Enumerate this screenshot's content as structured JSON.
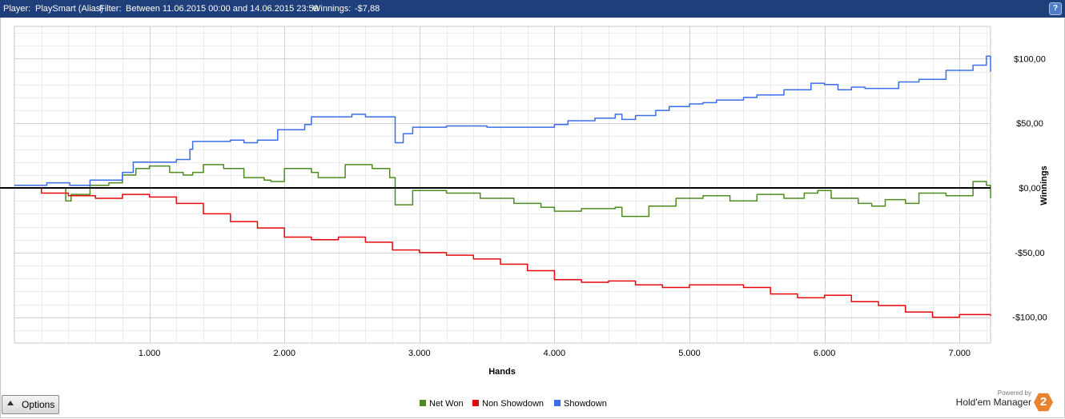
{
  "header": {
    "player_label": "Player:",
    "player_value": "PlaySmart (Alias)",
    "filter_label": "Filter:",
    "filter_value": "Between 11.06.2015 00:00 and 14.06.2015 23:59",
    "winnings_label": "Winnings:",
    "winnings_value": "-$7,88",
    "help_glyph": "?"
  },
  "options_button": {
    "label": "Options"
  },
  "branding": {
    "powered_by": "Powered by",
    "name": "Hold'em Manager",
    "badge": "2"
  },
  "colors": {
    "net_won": "#4d8b1f",
    "non_showdown": "#e8070a",
    "showdown": "#3a6ee8",
    "titlebar": "#1f3f7a",
    "zero_line": "#000000"
  },
  "chart_data": {
    "type": "line",
    "xlabel": "Hands",
    "ylabel": "Winnings",
    "xlim": [
      0,
      7230
    ],
    "ylim": [
      -120,
      125
    ],
    "x_ticks": [
      1000,
      2000,
      3000,
      4000,
      5000,
      6000,
      7000
    ],
    "x_tick_labels": [
      "1.000",
      "2.000",
      "3.000",
      "4.000",
      "5.000",
      "6.000",
      "7.000"
    ],
    "y_ticks": [
      100,
      50,
      0,
      -50,
      -100
    ],
    "y_tick_labels": [
      "$100,00",
      "$50,00",
      "$0,00",
      "-$50,00",
      "-$100,00"
    ],
    "grid": true,
    "legend_position": "bottom-center",
    "series": [
      {
        "name": "Net Won",
        "color": "#4d8b1f",
        "x": [
          0,
          200,
          380,
          420,
          560,
          700,
          800,
          900,
          1000,
          1150,
          1250,
          1320,
          1400,
          1550,
          1700,
          1850,
          1900,
          2000,
          2200,
          2250,
          2450,
          2650,
          2780,
          2820,
          2950,
          3200,
          3450,
          3700,
          3900,
          4000,
          4200,
          4450,
          4500,
          4700,
          4900,
          5100,
          5300,
          5500,
          5700,
          5850,
          5950,
          6050,
          6250,
          6350,
          6450,
          6600,
          6700,
          6900,
          7100,
          7200,
          7230
        ],
        "values": [
          0,
          0,
          -10,
          -5,
          2,
          4,
          10,
          15,
          17,
          12,
          10,
          12,
          18,
          15,
          8,
          6,
          5,
          15,
          12,
          8,
          18,
          15,
          8,
          -13,
          -2,
          -4,
          -8,
          -12,
          -15,
          -18,
          -16,
          -15,
          -22,
          -14,
          -8,
          -6,
          -10,
          -5,
          -8,
          -4,
          -2,
          -8,
          -12,
          -14,
          -9,
          -12,
          -4,
          -6,
          5,
          2,
          -8
        ]
      },
      {
        "name": "Non Showdown",
        "color": "#e8070a",
        "x": [
          0,
          200,
          400,
          600,
          800,
          1000,
          1200,
          1400,
          1600,
          1800,
          2000,
          2200,
          2400,
          2600,
          2800,
          3000,
          3200,
          3400,
          3600,
          3800,
          4000,
          4200,
          4400,
          4600,
          4800,
          5000,
          5200,
          5400,
          5600,
          5800,
          6000,
          6200,
          6400,
          6600,
          6800,
          7000,
          7230
        ],
        "values": [
          0,
          -4,
          -6,
          -8,
          -5,
          -7,
          -12,
          -20,
          -26,
          -31,
          -38,
          -40,
          -38,
          -42,
          -48,
          -50,
          -52,
          -55,
          -59,
          -64,
          -71,
          -73,
          -72,
          -75,
          -77,
          -75,
          -75,
          -77,
          -82,
          -85,
          -83,
          -88,
          -91,
          -96,
          -100,
          -98,
          -99
        ]
      },
      {
        "name": "Showdown",
        "color": "#3a6ee8",
        "x": [
          0,
          200,
          240,
          400,
          410,
          560,
          580,
          800,
          880,
          1000,
          1200,
          1300,
          1320,
          1400,
          1600,
          1700,
          1800,
          1950,
          2000,
          2150,
          2200,
          2400,
          2500,
          2600,
          2780,
          2820,
          2880,
          2950,
          3100,
          3200,
          3500,
          3900,
          4000,
          4100,
          4300,
          4450,
          4500,
          4600,
          4750,
          4850,
          5000,
          5100,
          5200,
          5400,
          5500,
          5700,
          5800,
          5900,
          6000,
          6100,
          6200,
          6300,
          6450,
          6550,
          6700,
          6900,
          7100,
          7200,
          7230
        ],
        "values": [
          2,
          2,
          4,
          4,
          2,
          6,
          6,
          12,
          20,
          20,
          22,
          30,
          36,
          36,
          37,
          35,
          37,
          45,
          45,
          49,
          55,
          55,
          57,
          55,
          55,
          35,
          42,
          47,
          47,
          48,
          47,
          47,
          49,
          52,
          54,
          57,
          53,
          56,
          60,
          63,
          65,
          66,
          68,
          70,
          72,
          76,
          76,
          81,
          80,
          76,
          78,
          77,
          77,
          82,
          84,
          91,
          95,
          102,
          90
        ]
      }
    ]
  }
}
